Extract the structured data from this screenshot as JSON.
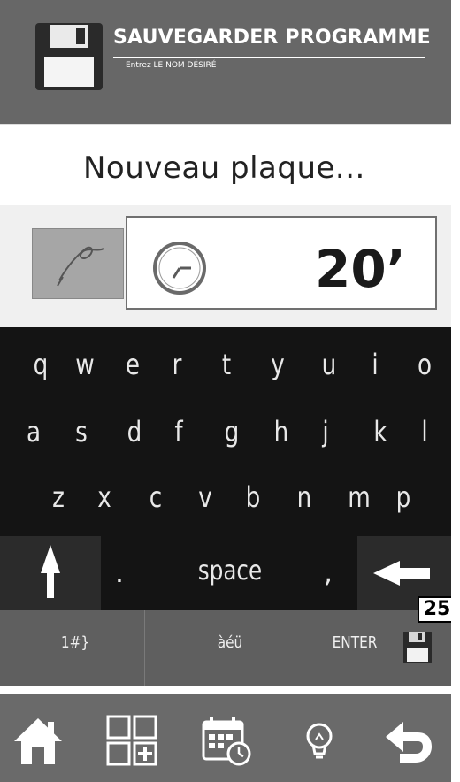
{
  "header": {
    "title": "SAUVEGARDER PROGRAMME",
    "subtitle": "Entrez LE NOM DÉSIRÉ",
    "icon": "floppy-disk-icon"
  },
  "name_field": {
    "value": "Nouveau plaque..."
  },
  "program_info": {
    "thumbnail_icon": "sketch-thumbnail",
    "clock_icon": "clock-icon",
    "time": "20’"
  },
  "keyboard": {
    "row1": [
      "q",
      "w",
      "e",
      "r",
      "t",
      "y",
      "u",
      "i",
      "o"
    ],
    "row2": [
      "a",
      "s",
      "d",
      "f",
      "g",
      "h",
      "j",
      "k",
      "l"
    ],
    "row3": [
      "z",
      "x",
      "c",
      "v",
      "b",
      "n",
      "m",
      "p"
    ],
    "dot": ".",
    "space": "space",
    "comma": ",",
    "shift_icon": "arrow-up-icon",
    "backspace_icon": "arrow-left-icon"
  },
  "function_row": {
    "numbers_label": "1#}",
    "accents_label": "àéü",
    "enter_label": "ENTER",
    "enter_icon": "floppy-small-icon"
  },
  "page_badge": "25",
  "nav": {
    "items": [
      "home-icon",
      "grid-add-icon",
      "calendar-clock-icon",
      "lightbulb-icon",
      "undo-arrow-icon"
    ]
  },
  "colors": {
    "header_bg": "#676767",
    "keyboard_bg": "#141414",
    "func_row_bg": "#5f5f5f",
    "nav_bg": "#6a6a6a"
  }
}
